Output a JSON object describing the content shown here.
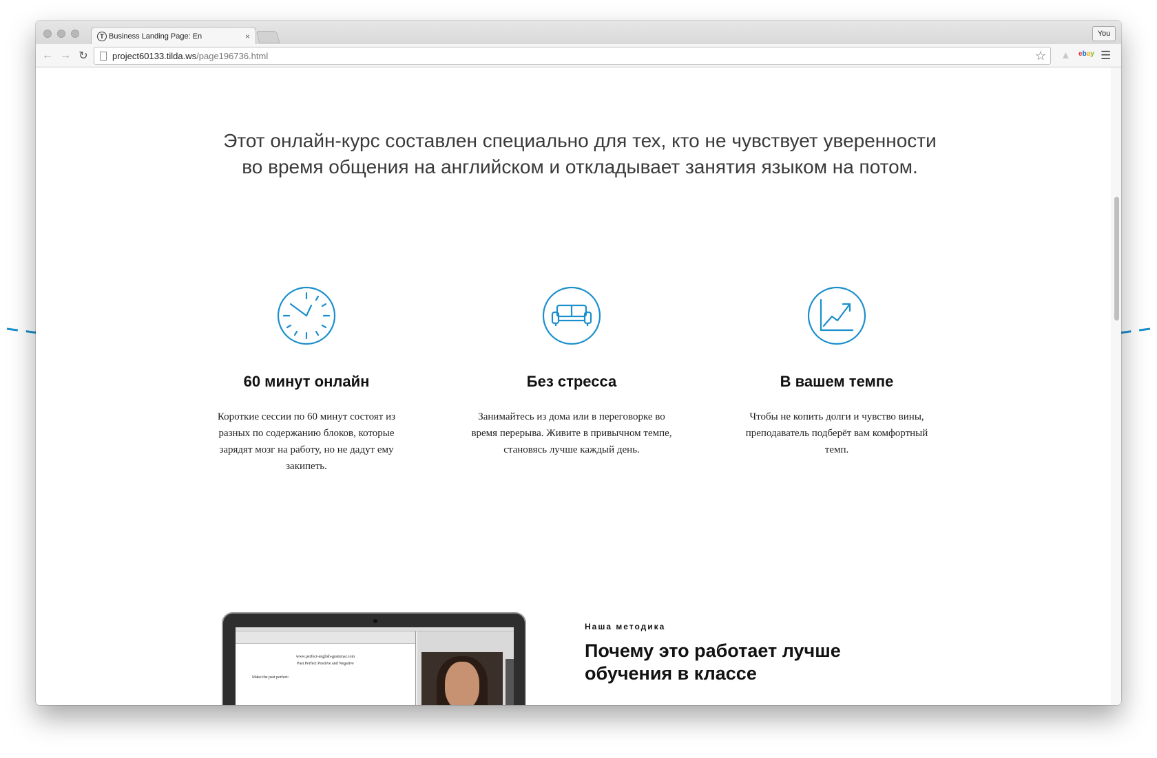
{
  "browser": {
    "tab_title": "Business Landing Page: En",
    "tab_favicon": "T",
    "tab_close": "×",
    "user_button": "You",
    "url_host": "project60133.tilda.ws",
    "url_path": "/page196736.html",
    "icons": [
      "back-icon",
      "forward-icon",
      "reload-icon",
      "page-icon",
      "star-icon",
      "extension-icon",
      "ebay-icon",
      "menu-icon"
    ],
    "ebay_letters": [
      "e",
      "b",
      "a",
      "y"
    ]
  },
  "intro": {
    "text": "Этот онлайн-курс составлен специально для тех, кто не чувствует уверенности во время общения на английском и откладывает занятия языком на потом."
  },
  "features": [
    {
      "icon": "clock-icon",
      "title": "60 минут онлайн",
      "text": "Короткие сессии по 60 минут состоят из разных по содержанию блоков, которые зарядят мозг на работу, но не дадут ему закипеть."
    },
    {
      "icon": "sofa-icon",
      "title": "Без стресса",
      "text": "Занимайтесь из дома или в переговорке во время перерыва. Живите в привычном темпе, становясь лучше каждый день."
    },
    {
      "icon": "growth-chart-icon",
      "title": "В вашем темпе",
      "text": "Чтобы не копить долги и чувство вины, преподаватель подберёт вам комфортный темп."
    }
  ],
  "method": {
    "kicker": "Наша методика",
    "title": "Почему это работает лучше обучения в классе"
  },
  "laptop_screen": {
    "doc_site": "www.perfect-english-grammar.com",
    "doc_heading": "Past Perfect Positive and Negative",
    "doc_instruction": "Make the past perfect:"
  },
  "colors": {
    "accent": "#1a8fcc",
    "arrow": "#1a8fcc",
    "text_dark": "#111111",
    "text_intro": "#3a3a3a"
  }
}
